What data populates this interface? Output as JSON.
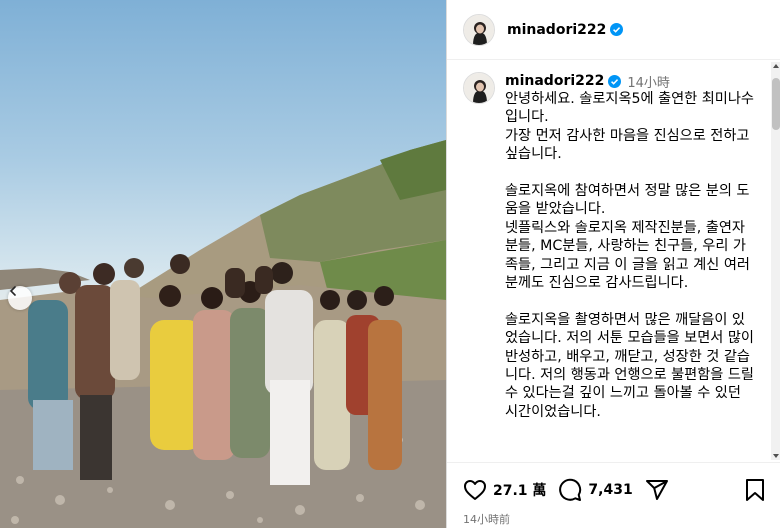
{
  "photo": {
    "description_icon": "group-photo"
  },
  "post": {
    "username": "minadori222",
    "verified_icon": "verified-badge-icon",
    "timestamp": "14小時",
    "caption": [
      "안녕하세요. 솔로지옥5에 출연한 최미나수입니다.",
      "가장 먼저 감사한 마음을 진심으로 전하고 싶습니다.",
      "솔로지옥에 참여하면서 정말 많은 분의 도움을 받았습니다.",
      "넷플릭스와 솔로지옥 제작진분들, 출연자분들, MC분들, 사랑하는 친구들, 우리 가족들, 그리고 지금 이 글을 읽고 계신 여러분께도 진심으로 감사드립니다.",
      "솔로지옥을 촬영하면서 많은 깨달음이 있었습니다. 저의 서툰 모습들을 보면서 많이 반성하고, 배우고, 깨닫고, 성장한 것 같습니다. 저의 행동과 언행으로 불편함을 드릴 수 있다는걸 깊이 느끼고 돌아볼 수 있던 시간이었습니다."
    ]
  },
  "actions": {
    "likes": "27.1 萬",
    "comments": "7,431",
    "posted_time": "14小時前"
  },
  "colors": {
    "verified": "#0095f6",
    "muted_text": "#737373"
  }
}
